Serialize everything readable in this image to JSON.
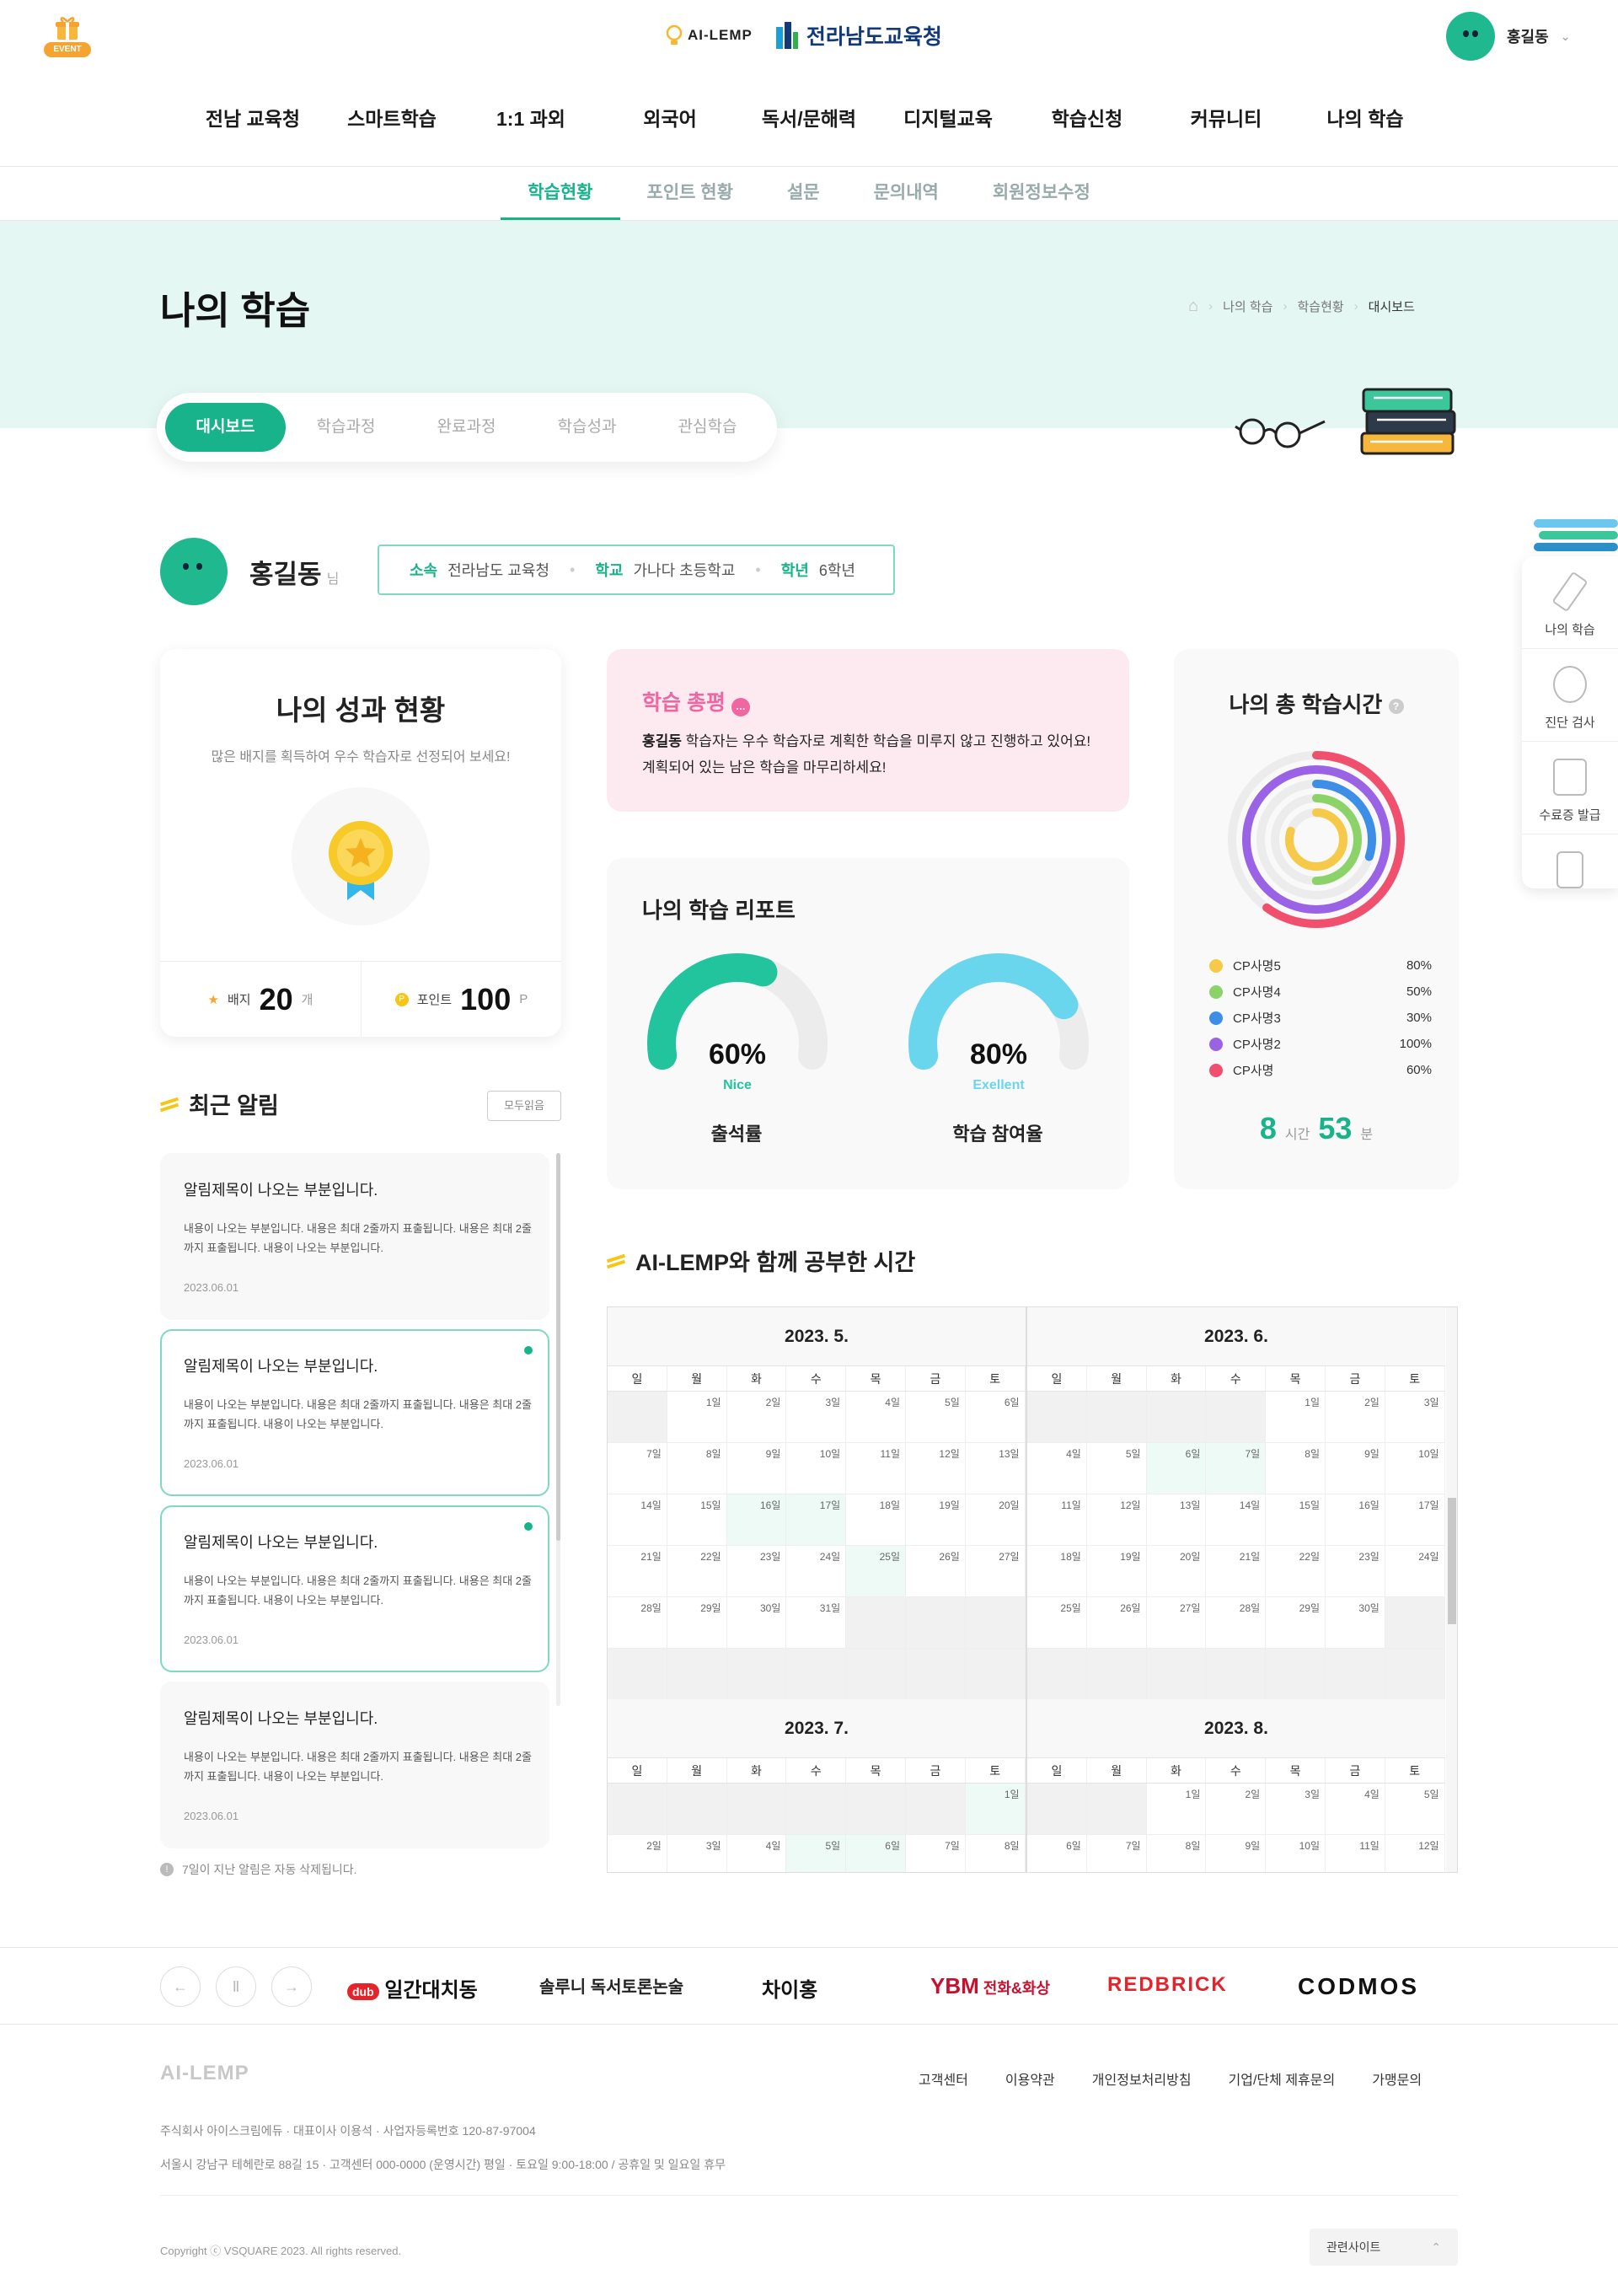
{
  "header": {
    "event_label": "EVENT",
    "ai_logo": "AI-LEMP",
    "edu_logo": "전라남도교육청",
    "user_name": "홍길동"
  },
  "gnb": [
    "전남 교육청",
    "스마트학습",
    "1:1 과외",
    "외국어",
    "독서/문해력",
    "디지털교육",
    "학습신청",
    "커뮤니티",
    "나의 학습"
  ],
  "subnav": {
    "items": [
      "학습현황",
      "포인트 현황",
      "설문",
      "문의내역",
      "회원정보수정"
    ],
    "active": "학습현황"
  },
  "page": {
    "title": "나의 학습",
    "breadcrumb": [
      "나의 학습",
      "학습현황",
      "대시보드"
    ]
  },
  "tabs": [
    "대시보드",
    "학습과정",
    "완료과정",
    "학습성과",
    "관심학습"
  ],
  "profile": {
    "name": "홍길동",
    "suffix": "님",
    "affiliation_label": "소속",
    "affiliation": "전라남도 교육청",
    "school_label": "학교",
    "school": "가나다 초등학교",
    "grade_label": "학년",
    "grade": "6학년"
  },
  "performance": {
    "title": "나의 성과 현황",
    "desc": "많은 배지를 획득하여 우수 학습자로 선정되어 보세요!",
    "badge_label": "배지",
    "badge_count": "20",
    "badge_unit": "개",
    "point_label": "포인트",
    "point_count": "100",
    "point_unit": "P"
  },
  "review": {
    "title": "학습 총평",
    "text_name": "홍길동",
    "text": " 학습자는 우수 학습자로 계획한 학습을 미루지 않고 진행하고 있어요! 계획되어 있는 남은 학습을 마무리하세요!"
  },
  "report": {
    "title": "나의 학습 리포트",
    "gauges": [
      {
        "value": "60%",
        "grade": "Nice",
        "label": "출석률",
        "percent": 60,
        "color": "#22c49d"
      },
      {
        "value": "80%",
        "grade": "Exellent",
        "label": "학습 참여율",
        "percent": 80,
        "color": "#6ad6ee"
      }
    ]
  },
  "total_time": {
    "title": "나의 총 학습시간",
    "items": [
      {
        "name": "CP사명5",
        "value": "80%",
        "percent": 80,
        "color": "#f7c948"
      },
      {
        "name": "CP사명4",
        "value": "50%",
        "percent": 50,
        "color": "#8bd368"
      },
      {
        "name": "CP사명3",
        "value": "30%",
        "percent": 30,
        "color": "#3c8ee6"
      },
      {
        "name": "CP사명2",
        "value": "100%",
        "percent": 100,
        "color": "#9a63e6"
      },
      {
        "name": "CP사명",
        "value": "60%",
        "percent": 60,
        "color": "#f0506e"
      }
    ],
    "hours": "8",
    "hours_unit": "시간",
    "minutes": "53",
    "minutes_unit": "분"
  },
  "notices": {
    "title": "최근 알림",
    "read_all": "모두읽음",
    "items": [
      {
        "title": "알림제목이 나오는 부분입니다.",
        "body": "내용이 나오는 부분입니다. 내용은 최대 2줄까지 표출됩니다. 내용은 최대 2줄까지 표출됩니다. 내용이 나오는 부분입니다.",
        "date": "2023.06.01",
        "new": false
      },
      {
        "title": "알림제목이 나오는 부분입니다.",
        "body": "내용이 나오는 부분입니다. 내용은 최대 2줄까지 표출됩니다. 내용은 최대 2줄까지 표출됩니다. 내용이 나오는 부분입니다.",
        "date": "2023.06.01",
        "new": true
      },
      {
        "title": "알림제목이 나오는 부분입니다.",
        "body": "내용이 나오는 부분입니다. 내용은 최대 2줄까지 표출됩니다. 내용은 최대 2줄까지 표출됩니다. 내용이 나오는 부분입니다.",
        "date": "2023.06.01",
        "new": true
      },
      {
        "title": "알림제목이 나오는 부분입니다.",
        "body": "내용이 나오는 부분입니다. 내용은 최대 2줄까지 표출됩니다. 내용은 최대 2줄까지 표출됩니다. 내용이 나오는 부분입니다.",
        "date": "2023.06.01",
        "new": false
      }
    ],
    "note": "7일이 지난 알림은 자동 삭제됩니다."
  },
  "calendar": {
    "title": "AI-LEMP와 함께 공부한 시간",
    "weekdays": [
      "일",
      "월",
      "화",
      "수",
      "목",
      "금",
      "토"
    ],
    "months": [
      {
        "label": "2023. 5.",
        "offset": 1,
        "days": 31,
        "rows": 6,
        "studied": [
          16,
          17,
          25
        ]
      },
      {
        "label": "2023. 6.",
        "offset": 4,
        "days": 30,
        "rows": 6,
        "studied": [
          6,
          7
        ]
      },
      {
        "label": "2023. 7.",
        "offset": 6,
        "days": 8,
        "rows": 2,
        "studied": [
          1,
          5,
          6
        ]
      },
      {
        "label": "2023. 8.",
        "offset": 2,
        "days": 12,
        "rows": 2,
        "studied": []
      }
    ],
    "day_suffix": "일"
  },
  "quick_menu": [
    "나의 학습",
    "진단 검사",
    "수료증 발급"
  ],
  "partners": [
    "일간대치동",
    "솔루니 독서토론논술",
    "차이홍",
    "전화&화상",
    "REDBRICK",
    "CODMOS"
  ],
  "footer": {
    "logo": "AI-LEMP",
    "menu": [
      "고객센터",
      "이용약관",
      "개인정보처리방침",
      "기업/단체 제휴문의",
      "가맹문의"
    ],
    "info1": "주식회사 아이스크림에듀 · 대표이사 이용석 · 사업자등록번호 120-87-97004",
    "info2": "서울시 강남구 테헤란로 88길 15 · 고객센터 000-0000 (운영시간) 평일 · 토요일 9:00-18:00 / 공휴일 및 일요일 휴무",
    "copyright": "Copyright ⓒ VSQUARE 2023. All rights reserved.",
    "related": "관련사이트"
  }
}
